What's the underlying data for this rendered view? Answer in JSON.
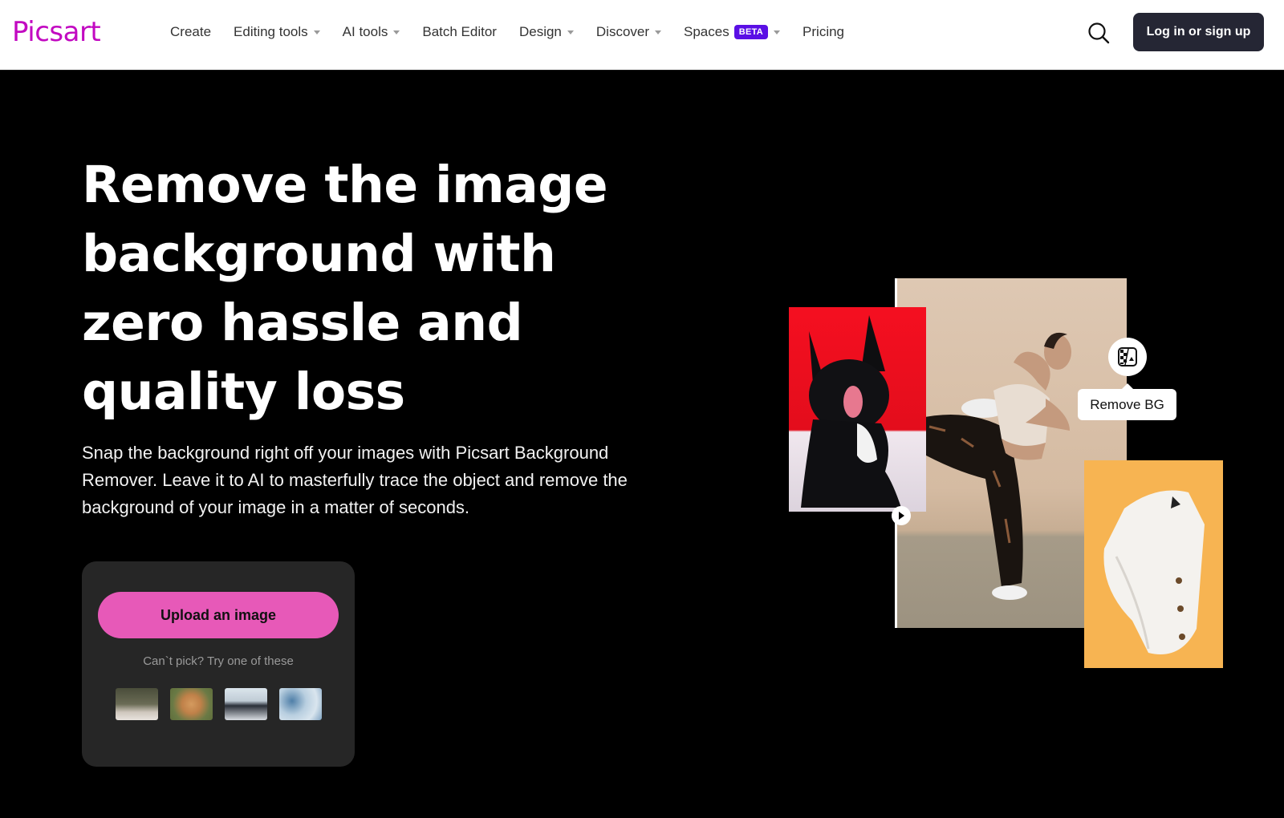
{
  "header": {
    "logo": "Picsart",
    "nav": [
      {
        "label": "Create",
        "has_dropdown": false
      },
      {
        "label": "Editing tools",
        "has_dropdown": true
      },
      {
        "label": "AI tools",
        "has_dropdown": true
      },
      {
        "label": "Batch Editor",
        "has_dropdown": false
      },
      {
        "label": "Design",
        "has_dropdown": true
      },
      {
        "label": "Discover",
        "has_dropdown": true
      },
      {
        "label": "Spaces",
        "has_dropdown": true,
        "badge": "BETA"
      },
      {
        "label": "Pricing",
        "has_dropdown": false
      }
    ],
    "search_icon": "search-icon",
    "login_label": "Log in or sign up"
  },
  "hero": {
    "title": "Remove the image background with zero hassle and quality loss",
    "description": "Snap the background right off your images with Picsart Background Remover. Leave it to AI to masterfully trace the object and remove the background of your image in a matter of seconds.",
    "upload_label": "Upload an image",
    "try_text": "Can`t pick? Try one of these",
    "sample_images": [
      {
        "name": "coffee-cup-sample"
      },
      {
        "name": "dog-sample"
      },
      {
        "name": "jumping-friends-sample"
      },
      {
        "name": "hand-sky-sample"
      }
    ]
  },
  "collage": {
    "remove_bg_label": "Remove BG",
    "remove_bg_icon": "remove-bg-icon"
  },
  "colors": {
    "brand": "#c209c1",
    "upload_button": "#e759b8",
    "beta_badge": "#5a0fe5",
    "login_button": "#252634",
    "background": "#000000",
    "card": "#262626"
  }
}
